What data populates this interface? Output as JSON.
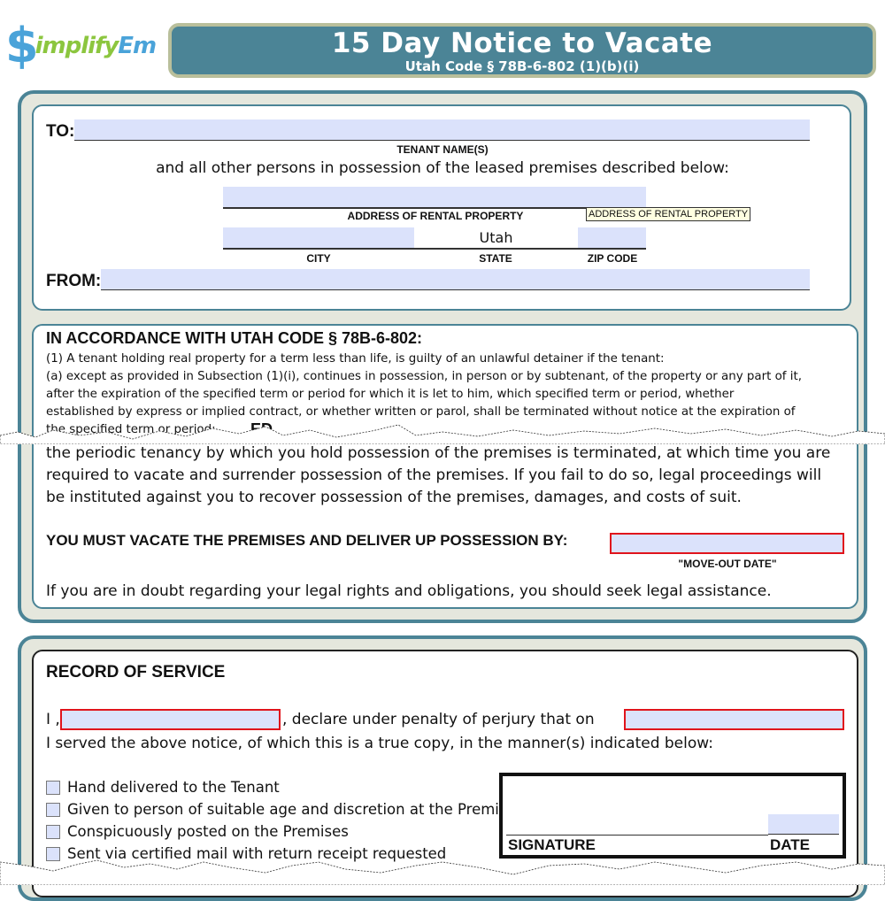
{
  "logo": {
    "dollar": "$",
    "text_a": "implify",
    "text_b": "Em"
  },
  "header": {
    "title": "15 Day Notice to Vacate",
    "subtitle": "Utah Code § 78B-6-802 (1)(b)(i)"
  },
  "parties": {
    "to_label": "TO:",
    "tenant_names_value": "",
    "tenant_names_caption": "TENANT NAME(S)",
    "persons_text": "and all other persons in possession of the leased premises described below:",
    "address_value": "",
    "address_caption": "ADDRESS OF RENTAL PROPERTY",
    "address_tooltip": "ADDRESS OF RENTAL PROPERTY",
    "city_value": "",
    "city_caption": "CITY",
    "state_value": "Utah",
    "state_caption": "STATE",
    "zip_value": "",
    "zip_caption": "ZIP CODE",
    "from_label": "FROM:",
    "from_value": ""
  },
  "statute": {
    "heading": "IN ACCORDANCE WITH UTAH CODE § 78B-6-802:",
    "lines": [
      "(1) A tenant holding real property for a term less than life, is guilty of an unlawful detainer if the tenant:",
      "(a) except as provided in Subsection (1)(i), continues in possession, in person or by subtenant, of the property or any part of it,",
      "after the expiration of the specified term or period for which it is let to him, which specified term or period, whether",
      "established by express or implied contract, or whether written or parol, shall be terminated without notice at the expiration of",
      "the specified term or period;"
    ],
    "overlap_fragment": "ED"
  },
  "notice": {
    "lines": [
      "the periodic tenancy by which you hold possession of the premises is terminated, at which time you are",
      "required to vacate and surrender possession of the premises. If you fail to do so, legal proceedings will",
      "be instituted against you to recover possession of the premises, damages, and costs of suit."
    ],
    "vacate_label": "YOU MUST VACATE THE PREMISES AND DELIVER UP POSSESSION BY:",
    "move_out_value": "",
    "move_out_caption": "\"MOVE-OUT DATE\"",
    "advice": "If you are in doubt regarding your legal rights and obligations, you should seek legal assistance."
  },
  "service": {
    "heading": "RECORD OF SERVICE",
    "i_prefix": "I ,",
    "server_name_value": "",
    "declare_text": ", declare under penalty of perjury that on",
    "service_date_value": "",
    "served_text": "I served the above notice, of which this is a true copy, in the manner(s) indicated below:",
    "methods": [
      {
        "label": "Hand delivered to the Tenant",
        "checked": false
      },
      {
        "label": "Given to person of suitable age and discretion at the Premises",
        "checked": false
      },
      {
        "label": "Conspicuously posted on the Premises",
        "checked": false
      },
      {
        "label": "Sent via certified mail with return receipt requested",
        "checked": false
      }
    ],
    "signature_caption": "SIGNATURE",
    "date_caption": "DATE",
    "date_value": ""
  },
  "colors": {
    "brand_teal": "#4b8496",
    "frame_olive": "#b9bf9b",
    "field_fill": "#dbe2fb",
    "required_red": "#e0141c",
    "logo_blue": "#4aa3d9",
    "logo_green": "#8cc63f"
  }
}
